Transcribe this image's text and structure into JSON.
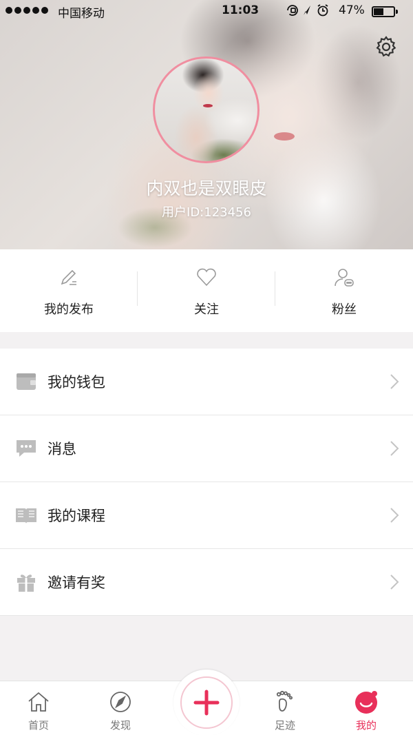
{
  "status_bar": {
    "carrier": "中国移动",
    "time": "11:03",
    "battery": "47%"
  },
  "profile": {
    "username": "内双也是双眼皮",
    "user_id": "用户ID:123456"
  },
  "stats": [
    {
      "label": "我的发布",
      "icon": "pencil-icon"
    },
    {
      "label": "关注",
      "icon": "heart-icon"
    },
    {
      "label": "粉丝",
      "icon": "person-chat-icon"
    }
  ],
  "menu": [
    {
      "label": "我的钱包",
      "icon": "wallet-icon"
    },
    {
      "label": "消息",
      "icon": "message-icon"
    },
    {
      "label": "我的课程",
      "icon": "book-icon"
    },
    {
      "label": "邀请有奖",
      "icon": "gift-icon"
    }
  ],
  "tabs": [
    {
      "label": "首页",
      "icon": "home-icon"
    },
    {
      "label": "发现",
      "icon": "compass-icon"
    },
    {
      "label": "足迹",
      "icon": "footprint-icon"
    },
    {
      "label": "我的",
      "icon": "smiley-icon",
      "active": true
    }
  ],
  "colors": {
    "accent": "#e8305a",
    "avatar_ring": "#f08ea0",
    "icon_gray": "#b8b8b8"
  }
}
